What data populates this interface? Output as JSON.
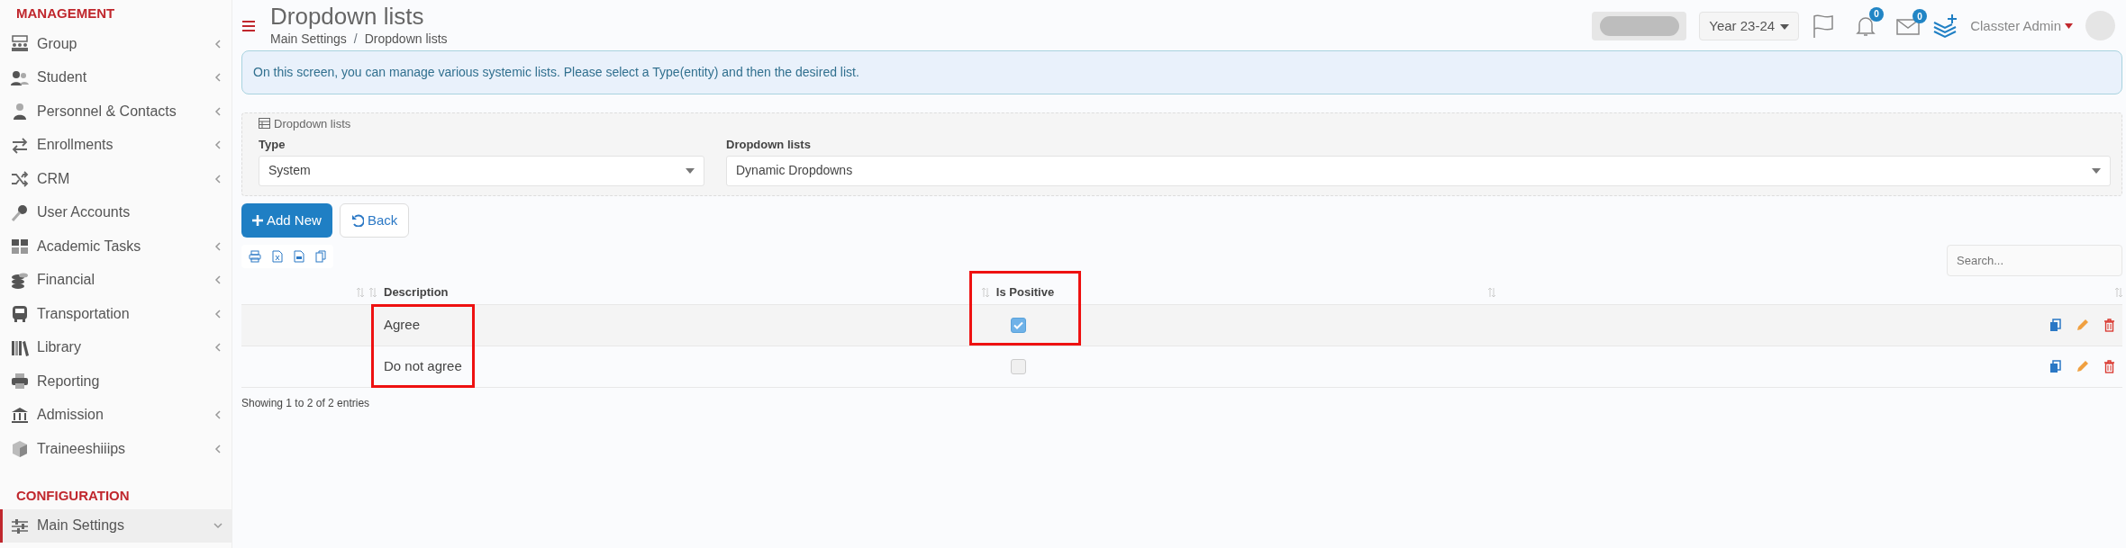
{
  "sidebar": {
    "sections": [
      {
        "title": "MANAGEMENT",
        "items": [
          {
            "label": "Group",
            "kind": "submenu",
            "expanded": false,
            "selected": false
          },
          {
            "label": "Student",
            "kind": "submenu",
            "expanded": false,
            "selected": false
          },
          {
            "label": "Personnel & Contacts",
            "kind": "submenu",
            "expanded": false,
            "selected": false
          },
          {
            "label": "Enrollments",
            "kind": "submenu",
            "expanded": false,
            "selected": false
          },
          {
            "label": "CRM",
            "kind": "submenu",
            "expanded": false,
            "selected": false
          },
          {
            "label": "User Accounts",
            "kind": "link",
            "selected": false
          },
          {
            "label": "Academic Tasks",
            "kind": "submenu",
            "expanded": false,
            "selected": false
          },
          {
            "label": "Financial",
            "kind": "submenu",
            "expanded": false,
            "selected": false
          },
          {
            "label": "Transportation",
            "kind": "submenu",
            "expanded": false,
            "selected": false
          },
          {
            "label": "Library",
            "kind": "submenu",
            "expanded": false,
            "selected": false
          },
          {
            "label": "Reporting",
            "kind": "link",
            "selected": false
          },
          {
            "label": "Admission",
            "kind": "submenu",
            "expanded": false,
            "selected": false
          },
          {
            "label": "Traineeshiiips",
            "kind": "submenu",
            "expanded": false,
            "selected": false
          }
        ]
      },
      {
        "title": "CONFIGURATION",
        "items": [
          {
            "label": "Main Settings",
            "kind": "submenu",
            "expanded": true,
            "selected": true
          }
        ]
      }
    ]
  },
  "header": {
    "title": "Dropdown lists",
    "breadcrumb": [
      "Main Settings",
      "Dropdown lists"
    ],
    "breadcrumb_separator": "/",
    "year": "Year 23-24",
    "notifications": "0",
    "messages": "0",
    "user": "Classter Admin"
  },
  "info": "On this screen, you can manage various systemic lists. Please select a Type(entity) and then the desired list.",
  "filters": {
    "legend": "Dropdown lists",
    "fields": [
      {
        "label": "Type",
        "value": "System"
      },
      {
        "label": "Dropdown lists",
        "value": "Dynamic Dropdowns"
      }
    ]
  },
  "buttons": [
    {
      "label": "Add New",
      "kind": "primary"
    },
    {
      "label": "Back",
      "kind": "back"
    }
  ],
  "search": {
    "placeholder": "Search..."
  },
  "table": {
    "columns": [
      {
        "label": "Description"
      },
      {
        "label": "Is Positive"
      }
    ],
    "rows": [
      {
        "description": "Agree",
        "is_positive": true
      },
      {
        "description": "Do not agree",
        "is_positive": false
      }
    ]
  },
  "highlight_frames": {
    "description_cells": true,
    "is_positive_header_first_row": true
  },
  "footer": "Showing 1 to 2 of 2 entries"
}
